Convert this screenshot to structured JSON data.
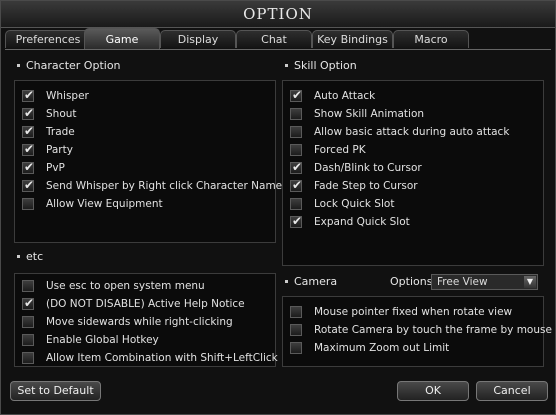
{
  "window": {
    "title": "OPTION"
  },
  "tabs": [
    {
      "label": "Preferences"
    },
    {
      "label": "Game"
    },
    {
      "label": "Display"
    },
    {
      "label": "Chat"
    },
    {
      "label": "Key Bindings"
    },
    {
      "label": "Macro"
    }
  ],
  "active_tab": "Game",
  "character_option": {
    "title": "Character Option",
    "items": [
      {
        "label": "Whisper",
        "checked": true
      },
      {
        "label": "Shout",
        "checked": true
      },
      {
        "label": "Trade",
        "checked": true
      },
      {
        "label": "Party",
        "checked": true
      },
      {
        "label": "PvP",
        "checked": true
      },
      {
        "label": "Send Whisper by Right click Character Name",
        "checked": true
      },
      {
        "label": "Allow View Equipment",
        "checked": false
      }
    ]
  },
  "skill_option": {
    "title": "Skill Option",
    "items": [
      {
        "label": "Auto Attack",
        "checked": true
      },
      {
        "label": "Show Skill Animation",
        "checked": false
      },
      {
        "label": "Allow basic attack during auto attack",
        "checked": false
      },
      {
        "label": "Forced PK",
        "checked": false
      },
      {
        "label": "Dash/Blink to Cursor",
        "checked": true
      },
      {
        "label": "Fade Step to Cursor",
        "checked": true
      },
      {
        "label": "Lock Quick Slot",
        "checked": false
      },
      {
        "label": "Expand Quick Slot",
        "checked": true
      }
    ]
  },
  "etc": {
    "title": "etc",
    "items": [
      {
        "label": "Use esc to open system menu",
        "checked": false
      },
      {
        "label": "(DO NOT DISABLE) Active Help Notice",
        "checked": true
      },
      {
        "label": "Move sidewards while right-clicking",
        "checked": false
      },
      {
        "label": "Enable Global Hotkey",
        "checked": false
      },
      {
        "label": "Allow Item Combination with Shift+LeftClick",
        "checked": false
      }
    ]
  },
  "camera": {
    "title": "Camera",
    "options_label": "Options",
    "options_value": "Free View",
    "items": [
      {
        "label": "Mouse pointer fixed when rotate view",
        "checked": false
      },
      {
        "label": "Rotate Camera by touch the frame by mouse",
        "checked": false
      },
      {
        "label": "Maximum Zoom out Limit",
        "checked": false
      }
    ]
  },
  "buttons": {
    "default": "Set to Default",
    "ok": "OK",
    "cancel": "Cancel"
  },
  "glyphs": {
    "check": "✔",
    "dropdown": "▼"
  }
}
